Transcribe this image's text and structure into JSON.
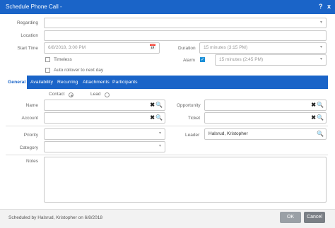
{
  "window": {
    "title": "Schedule Phone Call -",
    "help_icon": "?",
    "close_icon": "x"
  },
  "form": {
    "regarding_label": "Regarding",
    "location_label": "Location",
    "start_time_label": "Start Time",
    "start_time_value": "6/8/2018, 3:00 PM",
    "duration_label": "Duration",
    "duration_value": "15 minutes (3:15 PM)",
    "timeless_label": "Timeless",
    "alarm_label": "Alarm",
    "alarm_value": "15 minutes (2:45 PM)",
    "auto_rollover_label": "Auto rollover to next day"
  },
  "tabs": [
    {
      "label": "General",
      "active": true
    },
    {
      "label": "Availability"
    },
    {
      "label": "Recurring"
    },
    {
      "label": "Attachments"
    },
    {
      "label": "Participants"
    }
  ],
  "general": {
    "contact_label": "Contact",
    "lead_label": "Lead",
    "name_label": "Name",
    "account_label": "Account",
    "opportunity_label": "Opportunity",
    "ticket_label": "Ticket",
    "priority_label": "Priority",
    "category_label": "Category",
    "leader_label": "Leader",
    "leader_value": "Halsrud, Kristopher",
    "notes_label": "Notes"
  },
  "footer": {
    "status_text": "Scheduled by Halsrud, Kristopher on 6/8/2018",
    "ok_label": "OK",
    "cancel_label": "Cancel"
  },
  "icons": {
    "clear": "✖",
    "search": "🔍",
    "calendar": "📅",
    "caret": "▾"
  },
  "colors": {
    "primary": "#1a64c8",
    "alarm_check": "#1a8fd8"
  }
}
